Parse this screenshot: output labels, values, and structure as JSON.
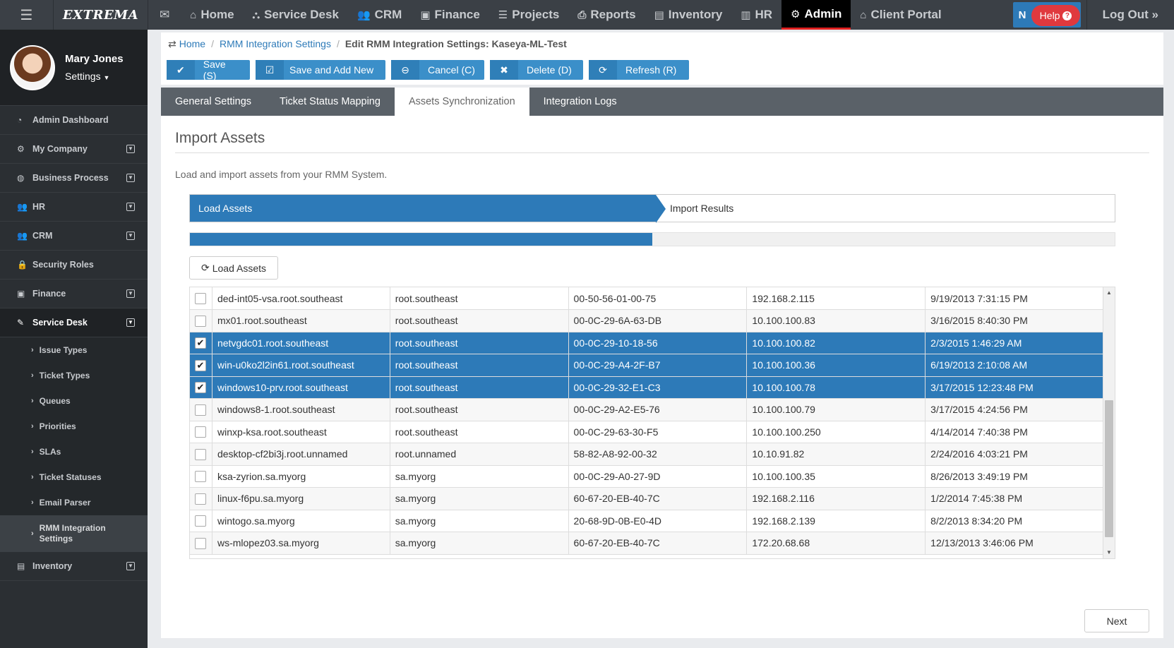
{
  "app": {
    "logo": "EXTREMA"
  },
  "topnav": {
    "menu_icon": "hamburger-icon",
    "items": [
      {
        "label": "Home",
        "icon": "home-icon"
      },
      {
        "label": "Service Desk",
        "icon": "sitemap-icon"
      },
      {
        "label": "CRM",
        "icon": "users-icon"
      },
      {
        "label": "Finance",
        "icon": "money-icon"
      },
      {
        "label": "Projects",
        "icon": "list-icon"
      },
      {
        "label": "Reports",
        "icon": "print-icon"
      },
      {
        "label": "Inventory",
        "icon": "building-icon"
      },
      {
        "label": "HR",
        "icon": "briefcase-icon"
      },
      {
        "label": "Admin",
        "icon": "gear-icon"
      },
      {
        "label": "Client Portal",
        "icon": "home-icon"
      }
    ],
    "active": "Admin",
    "n_label": "N",
    "help_label": "Help",
    "logout_label": "Log Out »"
  },
  "user": {
    "name": "Mary Jones",
    "settings_label": "Settings"
  },
  "sidebar": {
    "items": [
      {
        "label": "Admin Dashboard",
        "icon": "dashboard-icon"
      },
      {
        "label": "My Company",
        "icon": "gear-icon"
      },
      {
        "label": "Business Process",
        "icon": "globe-icon"
      },
      {
        "label": "HR",
        "icon": "users-icon"
      },
      {
        "label": "CRM",
        "icon": "users-icon"
      },
      {
        "label": "Security Roles",
        "icon": "lock-icon"
      },
      {
        "label": "Finance",
        "icon": "money-icon"
      },
      {
        "label": "Service Desk",
        "icon": "wrench-icon"
      }
    ],
    "sub_items": [
      "Issue Types",
      "Ticket Types",
      "Queues",
      "Priorities",
      "SLAs",
      "Ticket Statuses",
      "Email Parser",
      "RMM Integration Settings"
    ],
    "last_item": {
      "label": "Inventory",
      "icon": "building-icon"
    }
  },
  "breadcrumb": {
    "home": "Home",
    "parent": "RMM Integration Settings",
    "current": "Edit RMM Integration Settings: Kaseya-ML-Test"
  },
  "toolbar": {
    "save": "Save (S)",
    "save_add": "Save and Add New",
    "cancel": "Cancel (C)",
    "delete": "Delete (D)",
    "refresh": "Refresh (R)"
  },
  "tabs": [
    "General Settings",
    "Ticket Status Mapping",
    "Assets Synchronization",
    "Integration Logs"
  ],
  "active_tab": "Assets Synchronization",
  "panel": {
    "title": "Import Assets",
    "description": "Load and import assets from your RMM System.",
    "step1": "Load Assets",
    "step2": "Import Results",
    "progress_fraction": 0.5,
    "load_button": "Load Assets",
    "next_button": "Next"
  },
  "assets": [
    {
      "checked": false,
      "name": "ded-int05-vsa.root.southeast",
      "group": "root.southeast",
      "mac": "00-50-56-01-00-75",
      "ip": "192.168.2.115",
      "date": "9/19/2013 7:31:15 PM"
    },
    {
      "checked": false,
      "name": "mx01.root.southeast",
      "group": "root.southeast",
      "mac": "00-0C-29-6A-63-DB",
      "ip": "10.100.100.83",
      "date": "3/16/2015 8:40:30 PM"
    },
    {
      "checked": true,
      "name": "netvgdc01.root.southeast",
      "group": "root.southeast",
      "mac": "00-0C-29-10-18-56",
      "ip": "10.100.100.82",
      "date": "2/3/2015 1:46:29 AM"
    },
    {
      "checked": true,
      "name": "win-u0ko2l2in61.root.southeast",
      "group": "root.southeast",
      "mac": "00-0C-29-A4-2F-B7",
      "ip": "10.100.100.36",
      "date": "6/19/2013 2:10:08 AM"
    },
    {
      "checked": true,
      "name": "windows10-prv.root.southeast",
      "group": "root.southeast",
      "mac": "00-0C-29-32-E1-C3",
      "ip": "10.100.100.78",
      "date": "3/17/2015 12:23:48 PM"
    },
    {
      "checked": false,
      "name": "windows8-1.root.southeast",
      "group": "root.southeast",
      "mac": "00-0C-29-A2-E5-76",
      "ip": "10.100.100.79",
      "date": "3/17/2015 4:24:56 PM"
    },
    {
      "checked": false,
      "name": "winxp-ksa.root.southeast",
      "group": "root.southeast",
      "mac": "00-0C-29-63-30-F5",
      "ip": "10.100.100.250",
      "date": "4/14/2014 7:40:38 PM"
    },
    {
      "checked": false,
      "name": "desktop-cf2bi3j.root.unnamed",
      "group": "root.unnamed",
      "mac": "58-82-A8-92-00-32",
      "ip": "10.10.91.82",
      "date": "2/24/2016 4:03:21 PM"
    },
    {
      "checked": false,
      "name": "ksa-zyrion.sa.myorg",
      "group": "sa.myorg",
      "mac": "00-0C-29-A0-27-9D",
      "ip": "10.100.100.35",
      "date": "8/26/2013 3:49:19 PM"
    },
    {
      "checked": false,
      "name": "linux-f6pu.sa.myorg",
      "group": "sa.myorg",
      "mac": "60-67-20-EB-40-7C",
      "ip": "192.168.2.116",
      "date": "1/2/2014 7:45:38 PM"
    },
    {
      "checked": false,
      "name": "wintogo.sa.myorg",
      "group": "sa.myorg",
      "mac": "20-68-9D-0B-E0-4D",
      "ip": "192.168.2.139",
      "date": "8/2/2013 8:34:20 PM"
    },
    {
      "checked": false,
      "name": "ws-mlopez03.sa.myorg",
      "group": "sa.myorg",
      "mac": "60-67-20-EB-40-7C",
      "ip": "172.20.68.68",
      "date": "12/13/2013 3:46:06 PM"
    }
  ]
}
